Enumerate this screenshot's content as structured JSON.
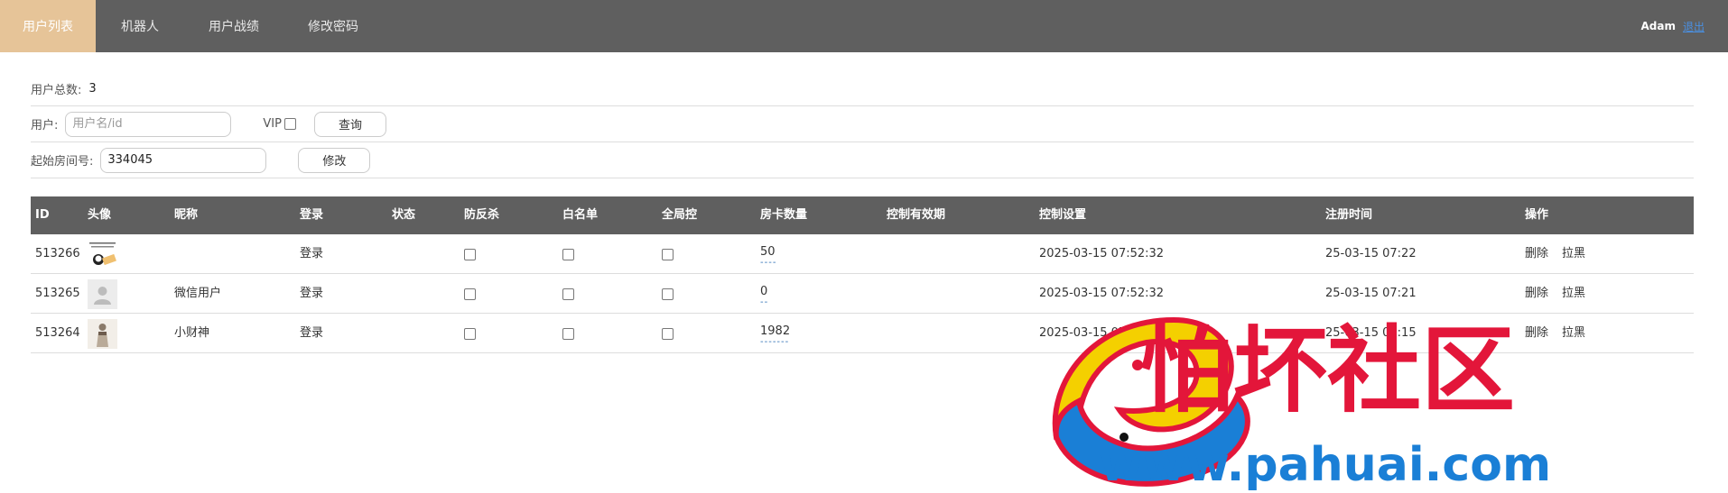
{
  "nav": {
    "items": [
      {
        "label": "用户列表",
        "active": true
      },
      {
        "label": "机器人",
        "active": false
      },
      {
        "label": "用户战绩",
        "active": false
      },
      {
        "label": "修改密码",
        "active": false
      }
    ],
    "user": "Adam",
    "logout": "退出"
  },
  "summary": {
    "total_label": "用户总数:",
    "total_value": "3"
  },
  "search": {
    "user_label": "用户:",
    "user_placeholder": "用户名/id",
    "vip_label": "VIP",
    "query_button": "查询"
  },
  "room": {
    "label": "起始房间号:",
    "value": "334045",
    "modify_button": "修改"
  },
  "table": {
    "headers": [
      "ID",
      "头像",
      "昵称",
      "登录",
      "状态",
      "防反杀",
      "白名单",
      "全局控",
      "房卡数量",
      "控制有效期",
      "控制设置",
      "注册时间",
      "操作"
    ],
    "rows": [
      {
        "id": "513266",
        "avatar": "meme-avatar",
        "nickname": "",
        "login": "登录",
        "status": "",
        "cards": "50",
        "cards_dots": "----",
        "control_setting": "2025-03-15 07:52:32",
        "register_time": "25-03-15 07:22",
        "delete": "删除",
        "block": "拉黑"
      },
      {
        "id": "513265",
        "avatar": "default-avatar",
        "nickname": "微信用户",
        "login": "登录",
        "status": "",
        "cards": "0",
        "cards_dots": "--",
        "control_setting": "2025-03-15 07:52:32",
        "register_time": "25-03-15 07:21",
        "delete": "删除",
        "block": "拉黑"
      },
      {
        "id": "513264",
        "avatar": "photo-avatar",
        "nickname": "小财神",
        "login": "登录",
        "status": "",
        "cards": "1982",
        "cards_dots": "-------",
        "control_setting": "2025-03-15 07:52:32",
        "register_time": "25-03-15 07:15",
        "delete": "删除",
        "block": "拉黑"
      }
    ]
  },
  "watermark": {
    "title": "怕坏社区",
    "url": "www.pahuai.com"
  },
  "colors": {
    "topbar": "#5f5f5f",
    "nav_active": "#e6c498",
    "link": "#4a90e2",
    "watermark_red": "#e3163a",
    "watermark_blue": "#1a7fd6"
  }
}
